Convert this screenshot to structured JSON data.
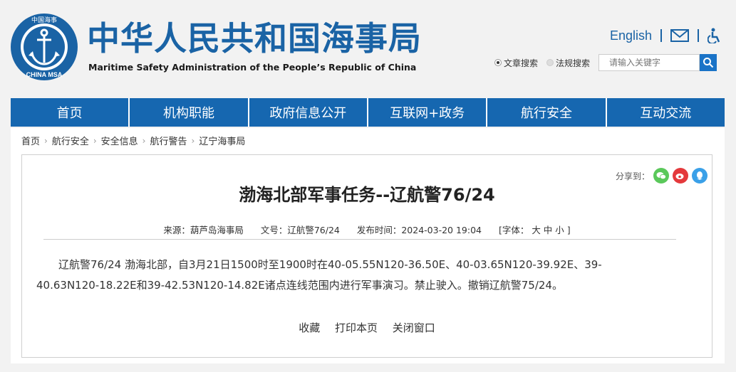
{
  "header": {
    "title_cn": "中华人民共和国海事局",
    "title_en": "Maritime Safety Administration of the People’s Republic of China",
    "logo_text_top": "中国海事",
    "logo_text_bottom": "CHINA MSA",
    "english_label": "English",
    "icons": [
      "mail-icon",
      "accessibility-icon",
      "search-icon"
    ],
    "search": {
      "options": [
        "文章搜索",
        "法规搜索"
      ],
      "selected": "文章搜索",
      "placeholder": "请输入关键字"
    }
  },
  "nav": {
    "items": [
      "首页",
      "机构职能",
      "政府信息公开",
      "互联网+政务",
      "航行安全",
      "互动交流"
    ]
  },
  "breadcrumb": [
    "首页",
    "航行安全",
    "安全信息",
    "航行警告",
    "辽宁海事局"
  ],
  "article": {
    "share_label": "分享到：",
    "title": "渤海北部军事任务--辽航警76/24",
    "source": "来源：葫芦岛海事局",
    "doc_no": "文号：辽航警76/24",
    "publish_time": "发布时间：2024-03-20 19:04",
    "font_size": "[字体： 大  中  小 ]",
    "body": "辽航警76/24 渤海北部，自3月21日1500时至1900时在40-05.55N120-36.50E、40-03.65N120-39.92E、39-40.63N120-18.22E和39-42.53N120-14.82E诸点连线范围内进行军事演习。禁止驶入。撤销辽航警75/24。",
    "actions": [
      "收藏",
      "打印本页",
      "关闭窗口"
    ]
  },
  "colors": {
    "brand_blue": "#1a63a5",
    "nav_blue": "#1667b0",
    "wechat": "#5ac85a",
    "weibo": "#e4393c",
    "qq": "#3aa0e8"
  }
}
